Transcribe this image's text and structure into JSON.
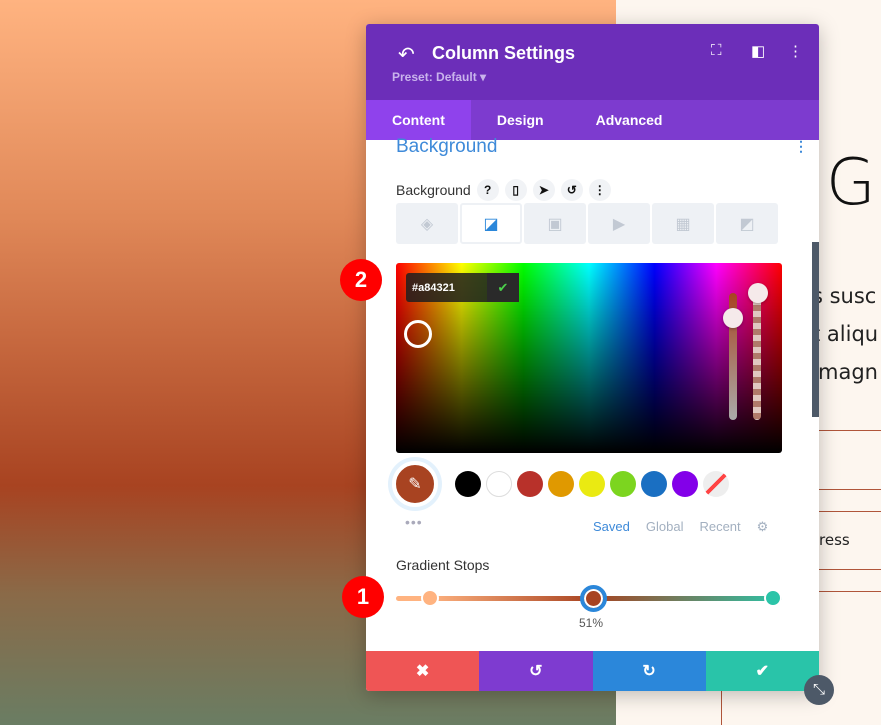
{
  "panel": {
    "title": "Column Settings",
    "preset": "Preset: Default ▾",
    "tabs": [
      "Content",
      "Design",
      "Advanced"
    ]
  },
  "section": {
    "title": "Background",
    "label": "Background",
    "help": "?"
  },
  "picker": {
    "hex": "#a84321",
    "current_color": "#a84321"
  },
  "swatches": [
    "#000000",
    "#ffffff",
    "#b8312a",
    "#e09900",
    "#eaea12",
    "#7cd51f",
    "#1a6fc2",
    "#8300e9",
    "transparent"
  ],
  "palette_tabs": {
    "saved": "Saved",
    "global": "Global",
    "recent": "Recent"
  },
  "gradient": {
    "label": "Gradient Stops",
    "stops": [
      {
        "color": "#ffb380",
        "position": 8
      },
      {
        "color": "#a84321",
        "position": 51
      },
      {
        "color": "#2bc4a8",
        "position": 100
      }
    ],
    "selected_label": "51%"
  },
  "page": {
    "heading": "G",
    "lines": [
      "s susc",
      "t aliqu",
      "magn"
    ],
    "item": "ress"
  },
  "markers": [
    "2",
    "1"
  ]
}
